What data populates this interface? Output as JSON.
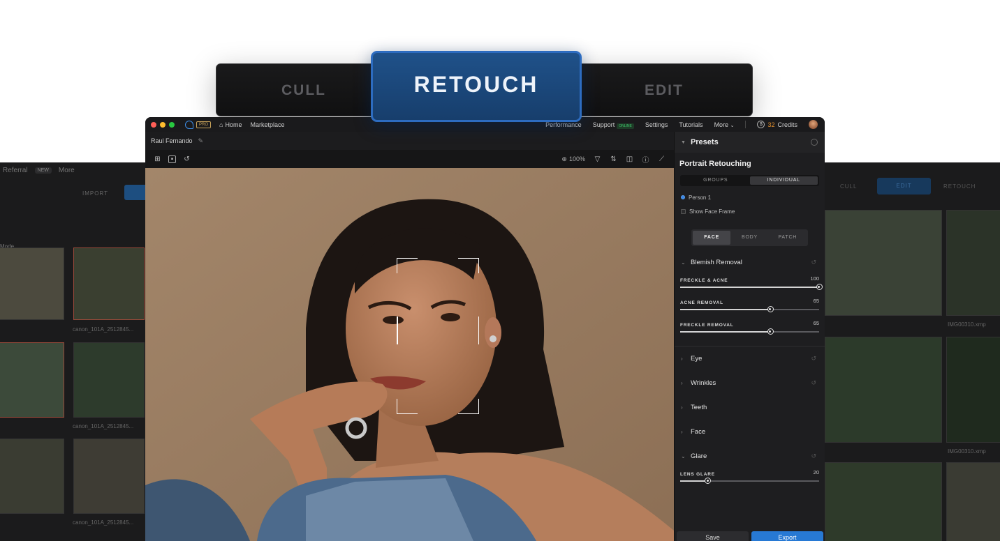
{
  "modes": {
    "cull": "CULL",
    "retouch": "RETOUCH",
    "edit": "EDIT"
  },
  "titlebar": {
    "pro_badge": "PRO",
    "home": "Home",
    "marketplace": "Marketplace",
    "performance": "Performance",
    "support": "Support",
    "online_badge": "ONLINE",
    "settings": "Settings",
    "tutorials": "Tutorials",
    "more": "More",
    "credits_count": "32",
    "credits_label": "Credits"
  },
  "project_name": "Raul Fernando",
  "toolbar": {
    "zoom": "100%"
  },
  "panel": {
    "header": "Presets",
    "preset_name": "Portrait Retouching",
    "scope_tabs": [
      "GROUPS",
      "INDIVIDUAL"
    ],
    "person": "Person 1",
    "show_face_frame": "Show Face Frame",
    "area_tabs": [
      "FACE",
      "BODY",
      "PATCH"
    ],
    "sections": {
      "blemish": "Blemish Removal",
      "eye": "Eye",
      "wrinkles": "Wrinkles",
      "teeth": "Teeth",
      "face": "Face",
      "glare": "Glare"
    },
    "sliders": [
      {
        "label": "FRECKLE & ACNE",
        "value": 100,
        "display": "100"
      },
      {
        "label": "ACNE REMOVAL",
        "value": 65,
        "display": "65"
      },
      {
        "label": "FRECKLE REMOVAL",
        "value": 65,
        "display": "65"
      },
      {
        "label": "LENS GLARE",
        "value": 20,
        "display": "20"
      }
    ],
    "save": "Save",
    "export": "Export"
  },
  "bg_left": {
    "referral": "Referral",
    "new_badge": "NEW",
    "more": "More",
    "import": "IMPORT",
    "mode": "Mode",
    "captions": [
      "canon_101A_2512845...",
      "canon_101A_2512845...",
      "canon_101A_2512845..."
    ]
  },
  "bg_right": {
    "tabs": [
      "CULL",
      "EDIT",
      "RETOUCH"
    ],
    "captions": [
      "IMG00310.xmp",
      "IMG00310.xmp"
    ]
  },
  "colors": {
    "accent": "#2779d4",
    "retouch_active": "#1f5189",
    "credits": "#e3902e",
    "online": "#3ec56a"
  }
}
